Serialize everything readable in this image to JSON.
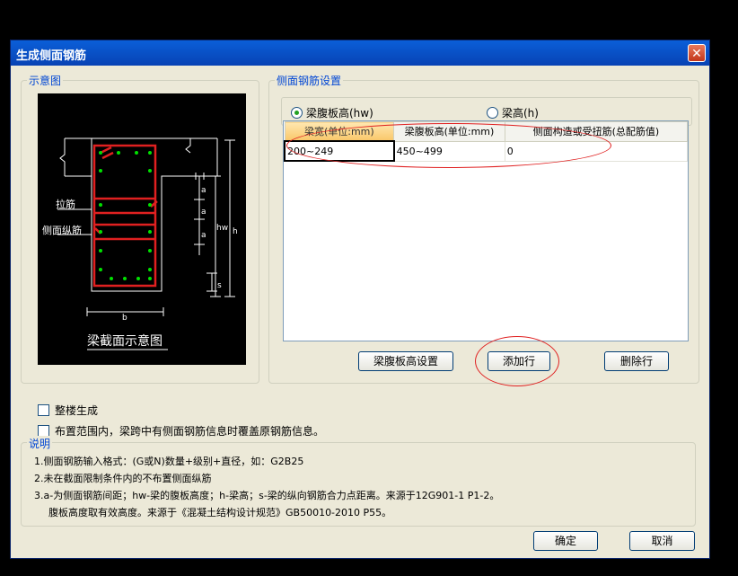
{
  "window": {
    "title": "生成侧面钢筋",
    "close_glyph": "✕"
  },
  "diagram_group": {
    "legend": "示意图",
    "labels": {
      "tie": "拉筋",
      "side_bar": "侧面纵筋",
      "a1": "a",
      "a2": "a",
      "a3": "a",
      "s": "s",
      "hw": "hw",
      "h": "h",
      "b": "b",
      "caption": "梁截面示意图"
    }
  },
  "settings_group": {
    "legend": "侧面钢筋设置",
    "radios": [
      {
        "label": "梁腹板高(hw)",
        "checked": true
      },
      {
        "label": "梁高(h)",
        "checked": false
      }
    ],
    "table": {
      "headers": [
        "梁宽(单位:mm)",
        "梁腹板高(单位:mm)",
        "侧面构造或受扭筋(总配筋值)"
      ],
      "rows": [
        [
          "200~249",
          "450~499",
          "0"
        ]
      ]
    },
    "buttons": {
      "web_height": "梁腹板高设置",
      "add_row": "添加行",
      "delete_row": "删除行"
    }
  },
  "options": {
    "whole_building": "整楼生成",
    "overwrite": "布置范围内，梁跨中有侧面钢筋信息时覆盖原钢筋信息。"
  },
  "notes": {
    "legend": "说明",
    "lines": [
      "1.侧面钢筋输入格式：(G或N)数量+级别+直径，如：G2B25",
      "2.未在截面限制条件内的不布置侧面纵筋",
      "3.a-为侧面钢筋间距；hw-梁的腹板高度；h-梁高；s-梁的纵向钢筋合力点距离。来源于12G901-1 P1-2。",
      "腹板高度取有效高度。来源于《混凝土结构设计规范》GB50010-2010 P55。"
    ]
  },
  "footer": {
    "ok": "确定",
    "cancel": "取消"
  },
  "colors": {
    "title_bar": "#0a52cc",
    "accent_blue": "#0046d5",
    "annotation_red": "#e02020",
    "rebar_green": "#00e000"
  }
}
